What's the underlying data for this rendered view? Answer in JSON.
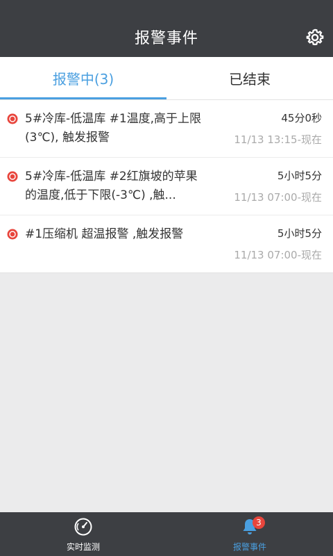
{
  "header": {
    "title": "报警事件",
    "settings_icon": "gear-icon"
  },
  "tabs": [
    {
      "label": "报警中(3)",
      "active": true
    },
    {
      "label": "已结束",
      "active": false
    }
  ],
  "alarms": [
    {
      "description": "5#冷库-低温库  #1温度,高于上限(3℃), 触发报警",
      "duration": "45分0秒",
      "time": "11/13 13:15-现在"
    },
    {
      "description": "5#冷库-低温库  #2红旗坡的苹果的温度,低于下限(-3℃) ,触...",
      "duration": "5小时5分",
      "time": "11/13 07:00-现在"
    },
    {
      "description": "#1压缩机 超温报警 ,触发报警",
      "duration": "5小时5分",
      "time": "11/13 07:00-现在"
    }
  ],
  "bottom_nav": [
    {
      "label": "实时监测",
      "icon": "speedometer-icon",
      "active": false
    },
    {
      "label": "报警事件",
      "icon": "bell-icon",
      "active": true,
      "badge": "3"
    }
  ],
  "colors": {
    "header_bg": "#3d3f43",
    "accent": "#4a9fe0",
    "alarm": "#e8453c"
  }
}
